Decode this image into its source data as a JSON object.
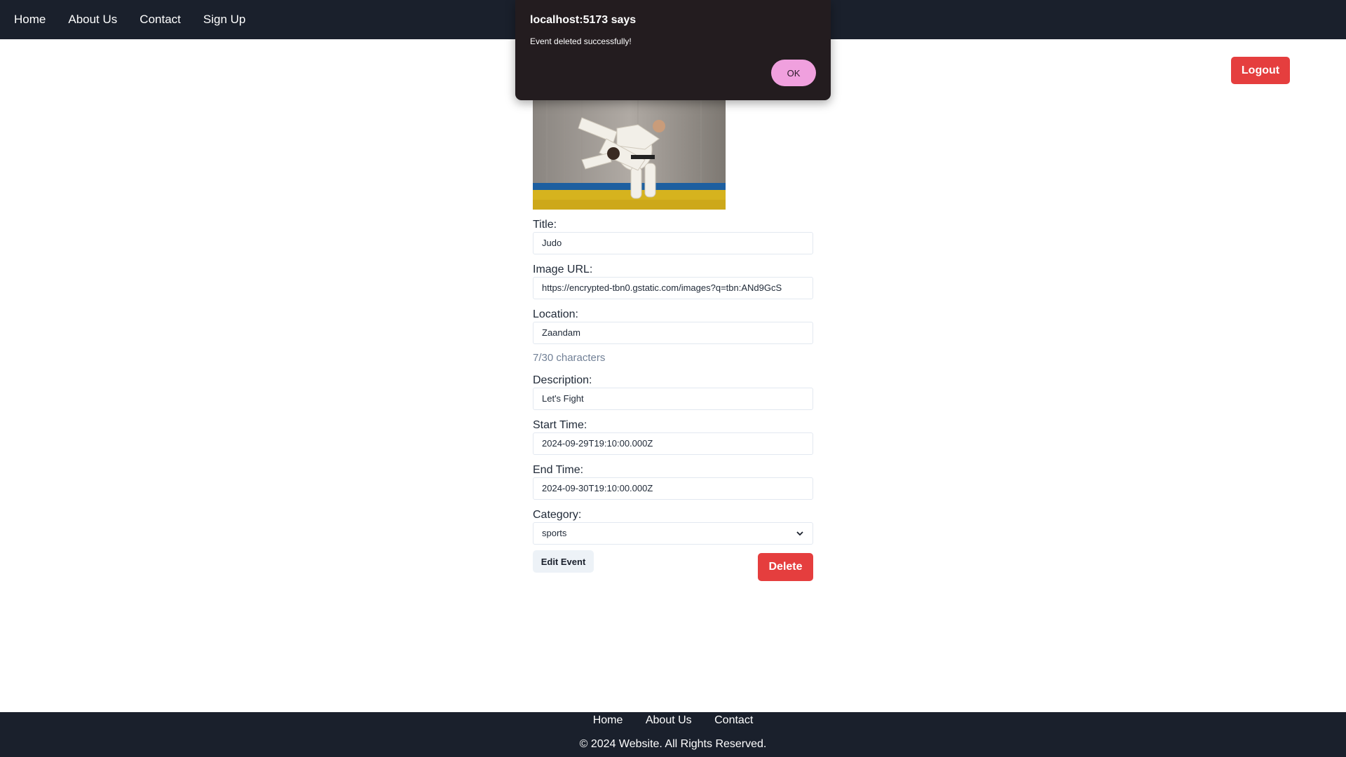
{
  "nav": {
    "items": [
      "Home",
      "About Us",
      "Contact",
      "Sign Up"
    ]
  },
  "header": {
    "logout_label": "Logout"
  },
  "form": {
    "title_label": "Title:",
    "title_value": "Judo",
    "image_url_label": "Image URL:",
    "image_url_value": "https://encrypted-tbn0.gstatic.com/images?q=tbn:ANd9GcS",
    "location_label": "Location:",
    "location_value": "Zaandam",
    "location_counter": "7/30 characters",
    "description_label": "Description:",
    "description_value": "Let's Fight",
    "start_time_label": "Start Time:",
    "start_time_value": "2024-09-29T19:10:00.000Z",
    "end_time_label": "End Time:",
    "end_time_value": "2024-09-30T19:10:00.000Z",
    "category_label": "Category:",
    "category_value": "sports",
    "edit_label": "Edit Event",
    "delete_label": "Delete"
  },
  "footer": {
    "links": [
      "Home",
      "About Us",
      "Contact"
    ],
    "copyright": "© 2024 Website. All Rights Reserved."
  },
  "dialog": {
    "title": "localhost:5173 says",
    "message": "Event deleted successfully!",
    "ok_label": "OK"
  },
  "colors": {
    "nav_bg": "#1a202c",
    "danger": "#e53e3e",
    "dialog_bg": "#231c1f",
    "dialog_button": "#f0a0de"
  },
  "icons": {
    "select_arrow": "chevron-down-icon"
  }
}
